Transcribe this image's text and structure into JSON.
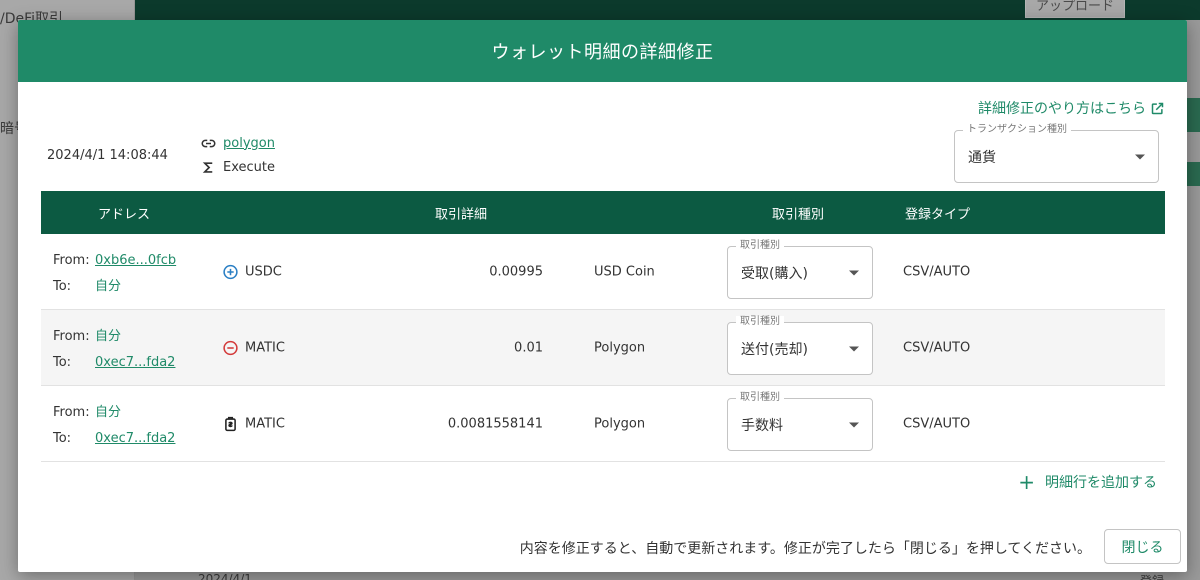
{
  "background": {
    "sidebar_label_1": "/DeFi取引",
    "sidebar_label_2": "暗号",
    "upload_button": "アップロード",
    "bottom_date": "2024/4/1",
    "bottom_btn": "登録"
  },
  "modal": {
    "title": "ウォレット明細の詳細修正",
    "howto_link": "詳細修正のやり方はこちら",
    "tx_date": "2024/4/1 14:08:44",
    "network": "polygon",
    "method": "Execute",
    "tx_type_legend": "トランザクション種別",
    "tx_type_value": "通貨"
  },
  "table": {
    "headers": {
      "address": "アドレス",
      "detail": "取引詳細",
      "type": "取引種別",
      "reg": "登録タイプ"
    },
    "from_label": "From:",
    "to_label": "To:",
    "select_legend": "取引種別",
    "rows": [
      {
        "from": "0xb6e...0fcb",
        "to": "自分",
        "icon": "plus-circle-icon",
        "symbol": "USDC",
        "amount": "0.00995",
        "coin_name": "USD Coin",
        "type": "受取(購入)",
        "reg": "CSV/AUTO"
      },
      {
        "from": "自分",
        "to": "0xec7...fda2",
        "icon": "minus-circle-icon",
        "symbol": "MATIC",
        "amount": "0.01",
        "coin_name": "Polygon",
        "type": "送付(売却)",
        "reg": "CSV/AUTO"
      },
      {
        "from": "自分",
        "to": "0xec7...fda2",
        "icon": "fee-icon",
        "symbol": "MATIC",
        "amount": "0.0081558141",
        "coin_name": "Polygon",
        "type": "手数料",
        "reg": "CSV/AUTO"
      }
    ]
  },
  "footer": {
    "add_row": "明細行を追加する",
    "note": "内容を修正すると、自動で更新されます。修正が完了したら「閉じる」を押してください。",
    "close": "閉じる"
  },
  "colors": {
    "accent": "#1f8a68",
    "table_header": "#0c5a42",
    "plus": "#2a7fc4",
    "minus": "#d33a3a"
  }
}
